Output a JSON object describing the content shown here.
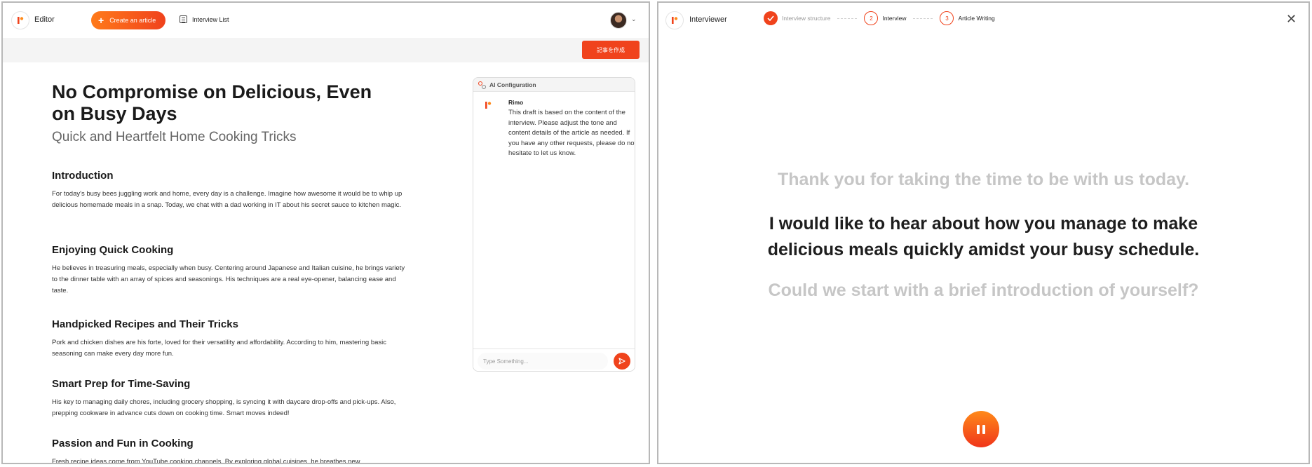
{
  "editor": {
    "app_title": "Editor",
    "create_button": "Create an article",
    "interview_list": "Interview List",
    "jp_button": "記事を作成",
    "article": {
      "title": "No Compromise on Delicious, Even on Busy Days",
      "subtitle": "Quick and Heartfelt Home Cooking Tricks",
      "sections": [
        {
          "heading": "Introduction",
          "body": "For today's busy bees juggling work and home, every day is a challenge. Imagine how awesome it would be to whip up delicious homemade meals in a snap. Today, we chat with a dad working in IT about his secret sauce to kitchen magic."
        },
        {
          "heading": "Enjoying Quick Cooking",
          "body": "He believes in treasuring meals, especially when busy. Centering around Japanese and Italian cuisine, he brings variety to the dinner table with an array of spices and seasonings. His techniques are a real eye-opener, balancing ease and taste."
        },
        {
          "heading": "Handpicked Recipes and Their Tricks",
          "body": "Pork and chicken dishes are his forte, loved for their versatility and affordability. According to him, mastering basic seasoning can make every day more fun."
        },
        {
          "heading": "Smart Prep for Time-Saving",
          "body": "His key to managing daily chores, including grocery shopping, is syncing it with daycare drop-offs and pick-ups. Also, prepping cookware in advance cuts down on cooking time. Smart moves indeed!"
        },
        {
          "heading": "Passion and Fun in Cooking",
          "body": "Fresh recipe ideas come from YouTube cooking channels. By exploring global cuisines, he breathes new"
        }
      ]
    },
    "ai_panel": {
      "header": "AI Configuration",
      "sender": "Rimo",
      "message": "This draft is based on the content of the interview. Please adjust the tone and content details of the article as needed. If you have any other requests, please do not hesitate to let us know.",
      "input_placeholder": "Type Something..."
    }
  },
  "interviewer": {
    "app_title": "Interviewer",
    "steps": [
      {
        "label": "Interview structure",
        "status": "done",
        "number": ""
      },
      {
        "label": "Interview",
        "status": "current",
        "number": "2"
      },
      {
        "label": "Article Writing",
        "status": "todo",
        "number": "3"
      }
    ],
    "previous_prompt": "Thank you for taking the time to be with us today.",
    "current_prompt_line1": "I would like to hear about how you manage to make",
    "current_prompt_line2": "delicious meals quickly amidst your busy schedule.",
    "next_prompt": "Could we start with a brief introduction of yourself?"
  },
  "colors": {
    "accent": "#f0431c",
    "accent_light": "#ff7a1a",
    "muted_text": "#c6c6c6"
  }
}
